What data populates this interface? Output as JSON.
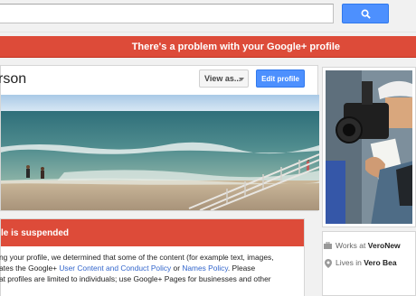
{
  "search": {
    "value": "",
    "placeholder": ""
  },
  "alert": {
    "text": "There's a problem with your Google+ profile"
  },
  "profile": {
    "name": "rson",
    "view_as_label": "View as...",
    "edit_label": "Edit profile"
  },
  "suspended": {
    "title": "le is suspended",
    "line1": "ng your profile, we determined that some of the content (for example text, images,",
    "line2_pre": "ates the Google+ ",
    "line2_link1": "User Content and Conduct Policy",
    "line2_mid": " or ",
    "line2_link2": "Names Policy",
    "line2_post": ". Please",
    "line3": "at profiles are limited to individuals; use Google+ Pages for businesses and other"
  },
  "info": {
    "works_label": "Works at",
    "works_value": "VeroNew",
    "lives_label": "Lives in",
    "lives_value": "Vero Bea"
  },
  "colors": {
    "alert_red": "#dd4b39",
    "button_blue": "#4d90fe",
    "link_blue": "#3366cc"
  }
}
